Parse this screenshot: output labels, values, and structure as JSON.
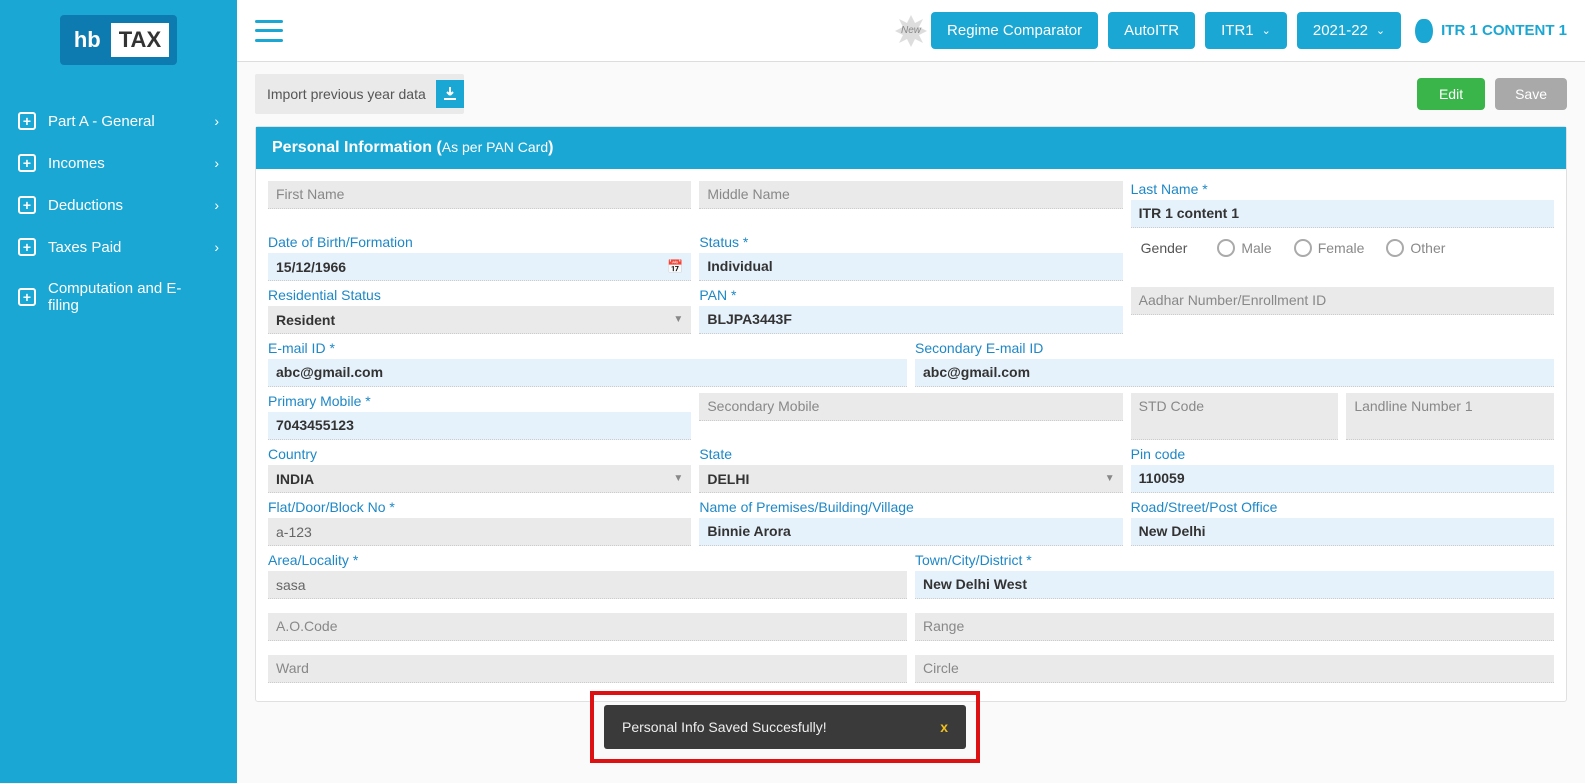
{
  "logo": {
    "hb": "hb",
    "tax": "TAX"
  },
  "sidebar": {
    "items": [
      {
        "label": "Part A - General"
      },
      {
        "label": "Incomes"
      },
      {
        "label": "Deductions"
      },
      {
        "label": "Taxes Paid"
      },
      {
        "label": "Computation and E-filing"
      }
    ]
  },
  "topbar": {
    "new_badge": "New",
    "regime": "Regime Comparator",
    "autoitr": "AutoITR",
    "itr": "ITR1",
    "year": "2021-22",
    "user": "ITR 1 CONTENT 1"
  },
  "actions": {
    "import": "Import previous year data",
    "edit": "Edit",
    "save": "Save"
  },
  "panel": {
    "title": "Personal Information (",
    "subtitle": "As per PAN Card",
    "title_end": ")"
  },
  "labels": {
    "first_name": "First Name",
    "middle_name": "Middle Name",
    "last_name": "Last Name *",
    "dob": "Date of Birth/Formation",
    "status": "Status *",
    "gender": "Gender",
    "male": "Male",
    "female": "Female",
    "other": "Other",
    "res_status": "Residential Status",
    "pan": "PAN *",
    "aadhar": "Aadhar Number/Enrollment ID",
    "email": "E-mail ID *",
    "sec_email": "Secondary E-mail ID",
    "pri_mobile": "Primary Mobile *",
    "sec_mobile": "Secondary Mobile",
    "std": "STD Code",
    "landline": "Landline Number 1",
    "country": "Country",
    "state": "State",
    "pin": "Pin code",
    "flat": "Flat/Door/Block No *",
    "premises": "Name of Premises/Building/Village",
    "road": "Road/Street/Post Office",
    "area": "Area/Locality *",
    "town": "Town/City/District *",
    "ao": "A.O.Code",
    "range": "Range",
    "ward": "Ward",
    "circle": "Circle"
  },
  "values": {
    "last_name": "ITR 1 content 1",
    "dob": "15/12/1966",
    "status": "Individual",
    "res_status": "Resident",
    "pan": "BLJPA3443F",
    "email": "abc@gmail.com",
    "sec_email": "abc@gmail.com",
    "pri_mobile": "7043455123",
    "country": "INDIA",
    "state": "DELHI",
    "pin": "110059",
    "flat": "a-123",
    "premises": "Binnie Arora",
    "road": "New Delhi",
    "area": "sasa",
    "town": "New Delhi West"
  },
  "toast": {
    "message": "Personal Info Saved Succesfully!",
    "close": "x"
  }
}
